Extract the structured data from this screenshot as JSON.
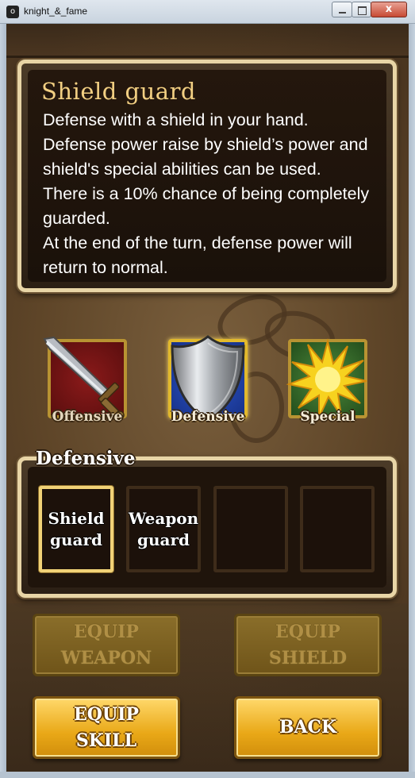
{
  "window": {
    "title": "knight_&_fame",
    "close_label": "x",
    "app_icon_label": "o"
  },
  "skill_info": {
    "name": "Shield guard",
    "description": "Defense with a shield in your hand.\nDefense power raise by shield’s power and shield's special abilities can be used.\nThere is a 10% chance of being completely guarded.\nAt the end of the turn, defense power will return to normal."
  },
  "categories": [
    {
      "label": "Offensive",
      "icon": "sword-icon",
      "selected": false
    },
    {
      "label": "Defensive",
      "icon": "shield-icon",
      "selected": true
    },
    {
      "label": "Special",
      "icon": "burst-icon",
      "selected": false
    }
  ],
  "skill_list": {
    "title": "Defensive",
    "slots": [
      {
        "label": "Shield\nguard",
        "selected": true
      },
      {
        "label": "Weapon\nguard",
        "selected": false
      },
      {
        "label": "",
        "selected": false
      },
      {
        "label": "",
        "selected": false
      }
    ]
  },
  "buttons": {
    "equip_weapon": {
      "label": "EQUIP\nWEAPON",
      "enabled": false
    },
    "equip_shield": {
      "label": "EQUIP\nSHIELD",
      "enabled": false
    },
    "equip_skill": {
      "label": "EQUIP\nSKILL",
      "enabled": true
    },
    "back": {
      "label": "BACK",
      "enabled": true
    }
  },
  "colors": {
    "title_gold": "#f2cf82",
    "active_button": "#e9a817",
    "selected_border": "#f1d277"
  }
}
